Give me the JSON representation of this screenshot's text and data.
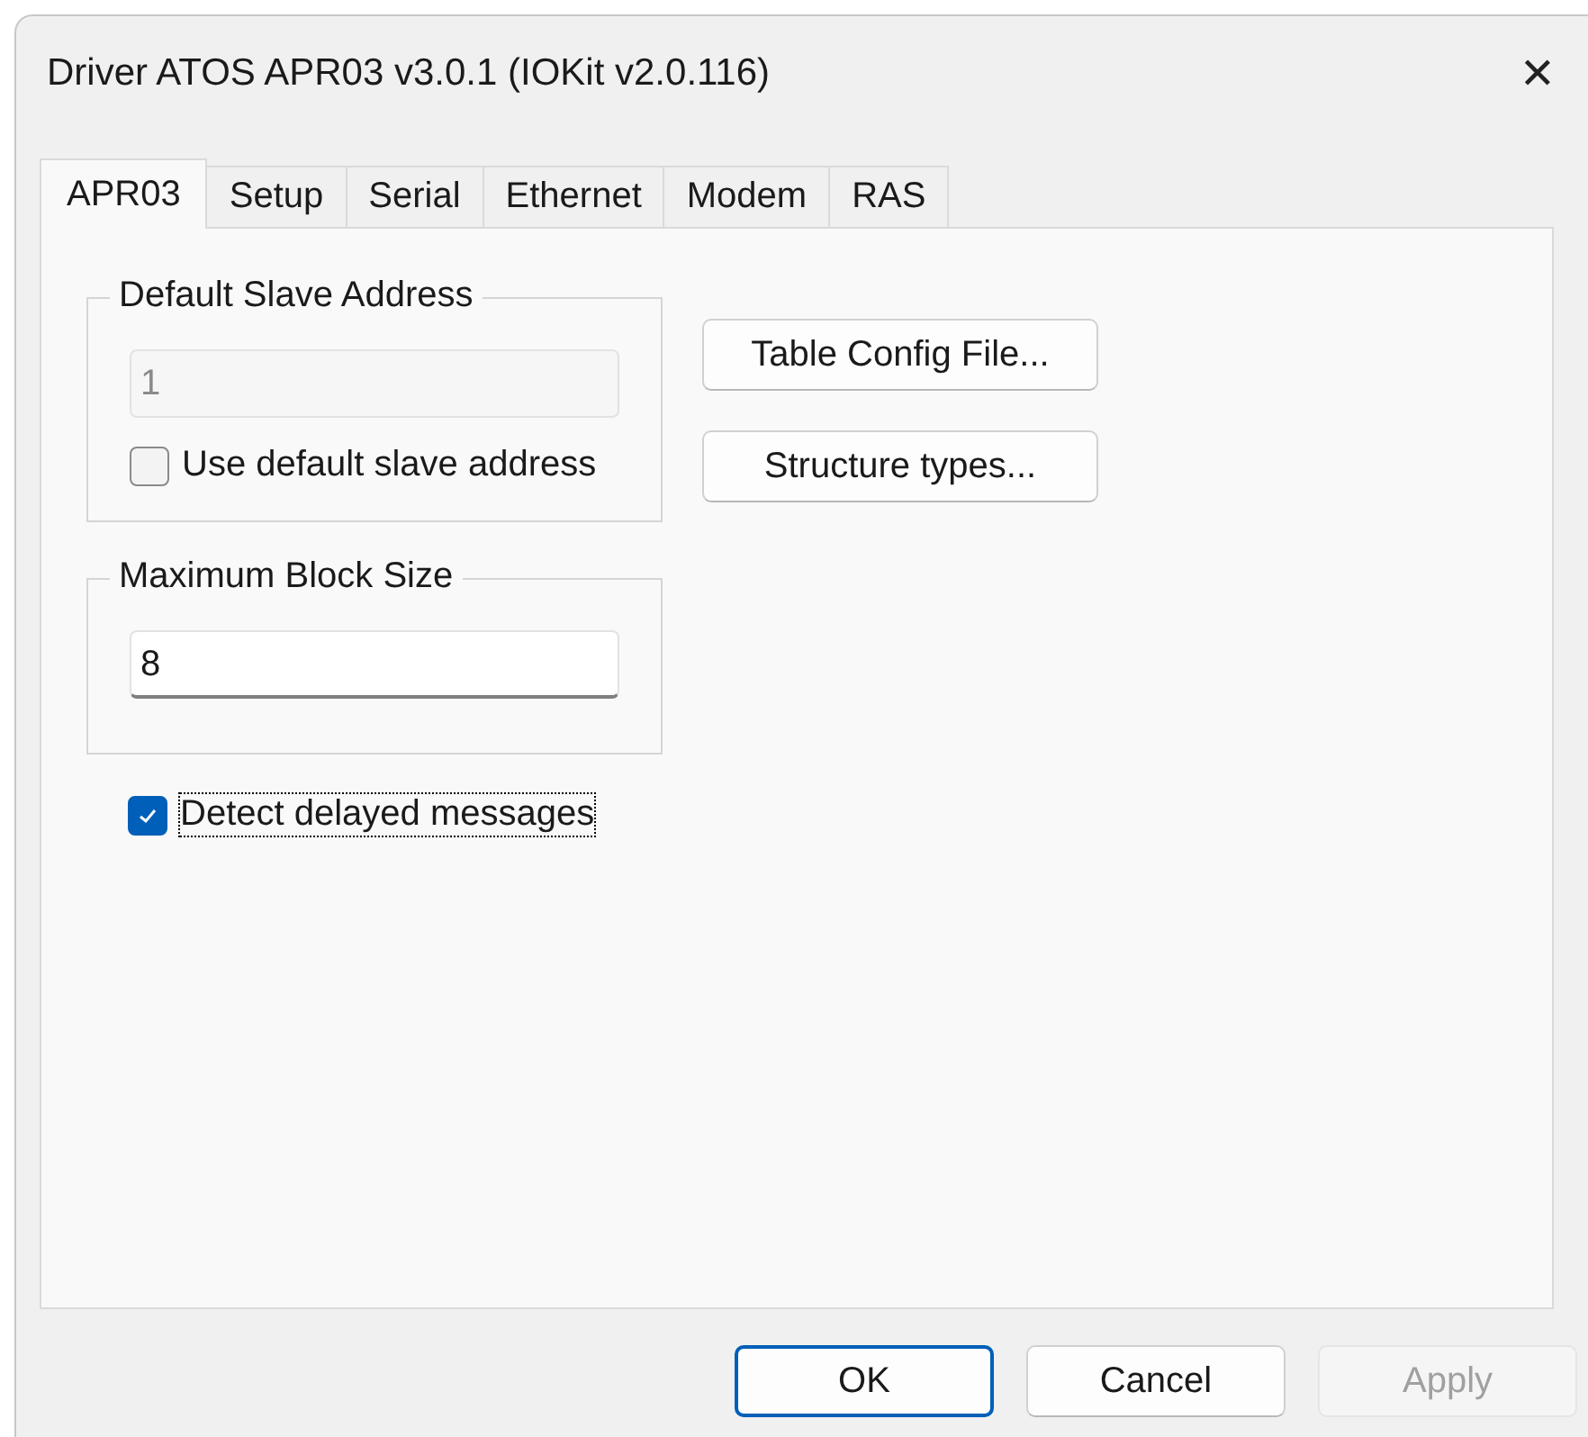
{
  "window": {
    "title": "Driver ATOS APR03 v3.0.1 (IOKit v2.0.116)",
    "close": "✕"
  },
  "tabs": [
    {
      "label": "APR03",
      "selected": true
    },
    {
      "label": "Setup",
      "selected": false
    },
    {
      "label": "Serial",
      "selected": false
    },
    {
      "label": "Ethernet",
      "selected": false
    },
    {
      "label": "Modem",
      "selected": false
    },
    {
      "label": "RAS",
      "selected": false
    }
  ],
  "groups": [
    {
      "title": "Default Slave Address",
      "field": {
        "value": "1",
        "disabled": true
      },
      "checkbox": {
        "label": "Use default slave address",
        "checked": false
      }
    },
    {
      "title": "Maximum Block Size",
      "field": {
        "value": "8",
        "disabled": false
      }
    }
  ],
  "side_buttons": [
    {
      "label": "Table Config File..."
    },
    {
      "label": "Structure types..."
    }
  ],
  "detect_checkbox": {
    "label": "Detect delayed messages",
    "checked": true,
    "focused": true
  },
  "buttons": [
    {
      "label": "OK",
      "default": true,
      "disabled": false
    },
    {
      "label": "Cancel",
      "default": false,
      "disabled": false
    },
    {
      "label": "Apply",
      "default": false,
      "disabled": true
    }
  ]
}
